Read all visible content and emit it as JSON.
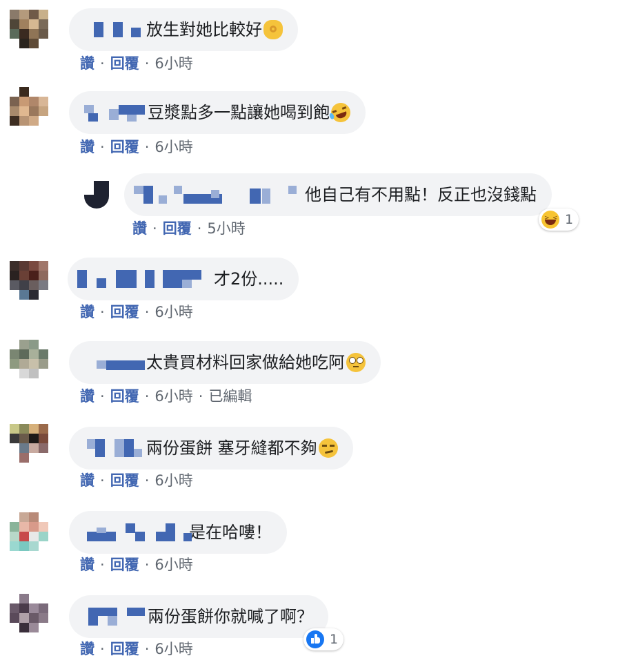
{
  "actions": {
    "like": "讚",
    "reply": "回覆",
    "separator": "·"
  },
  "comments": [
    {
      "text": "放生對她比較好",
      "emoji": "ok-hand-icon",
      "time": "6小時"
    },
    {
      "text": "豆漿點多一點讓她喝到飽",
      "emoji": "rolling-laughing-icon",
      "time": "6小時"
    },
    {
      "text": "他自己有不用點！反正也沒錢點",
      "time": "5小時",
      "reaction": {
        "icon": "laughing-squint-icon",
        "count": "1"
      }
    },
    {
      "text": "才2份.....",
      "time": "6小時"
    },
    {
      "text": "太貴買材料回家做給她吃阿",
      "emoji": "eye-roll-icon",
      "time": "6小時",
      "edited": "已編輯"
    },
    {
      "text": "兩份蛋餅 塞牙縫都不夠",
      "emoji": "smirk-icon",
      "time": "6小時"
    },
    {
      "text": "是在哈嘍！",
      "time": "6小時"
    },
    {
      "text": "兩份蛋餅你就喊了啊？",
      "time": "6小時",
      "reaction": {
        "icon": "thumbs-up-icon",
        "count": "1"
      }
    }
  ],
  "colors": {
    "link": "#4267b2",
    "bubble": "#f2f3f5",
    "meta": "#606770"
  }
}
